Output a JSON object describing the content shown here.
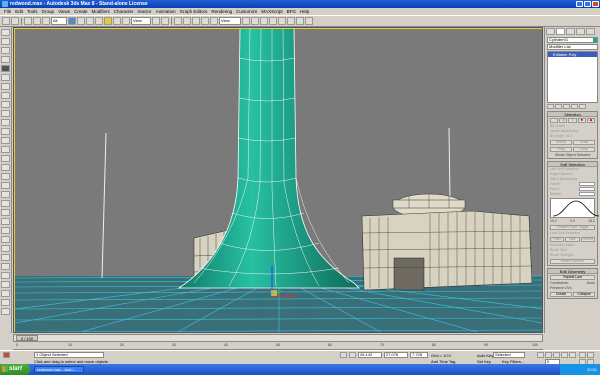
{
  "window": {
    "title": "redwood.max - Autodesk 3ds Max 8 - Stand-alone License"
  },
  "menu": [
    "File",
    "Edit",
    "Tools",
    "Group",
    "Views",
    "Create",
    "Modifiers",
    "Character",
    "reactor",
    "Animation",
    "Graph Editors",
    "Rendering",
    "Customize",
    "MAXScript",
    "BFG",
    "Help"
  ],
  "toolbar": {
    "selection_filter": "All",
    "ref_coord": "View",
    "named_sel": "View"
  },
  "command_panel": {
    "object_name": "Cylinder01",
    "modifier_list": "Modifier List",
    "stack_item": "Editable Poly",
    "selection": {
      "title": "Selection",
      "by_vertex": "By Vertex",
      "ignore_backfacing": "Ignore Backfacing",
      "by_angle": "By Angle:",
      "by_angle_value": "45.0",
      "shrink": "Shrink",
      "grow": "Grow",
      "ring": "Ring",
      "loop": "Loop",
      "status": "Whole Object Selected"
    },
    "soft_selection": {
      "title": "Soft Selection",
      "use_soft": "Use Soft Selection",
      "edge_distance": "Edge Distance",
      "affect_backfacing": "Affect Backfacing",
      "falloff": "Falloff:",
      "pinch": "Pinch:",
      "bubble": "Bubble:",
      "curve_left": "15.2",
      "curve_mid": "0.0",
      "curve_right": "15.2",
      "shaded_face_toggle": "Shaded Face Toggle",
      "lock_soft": "Lock Soft Selection",
      "paint": "Paint",
      "blur": "Blur",
      "revert": "Revert",
      "selection_value": "Selection Value",
      "brush_size": "Brush Size",
      "brush_strength": "Brush Strength",
      "brush_options": "Brush Options"
    },
    "edit_geometry": {
      "title": "Edit Geometry",
      "repeat_last": "Repeat Last",
      "constraints": "Constraints:",
      "constraints_value": "None",
      "preserve_uvs": "Preserve UVs",
      "create": "Create",
      "collapse": "Collapse"
    }
  },
  "timeslider": {
    "label": "0 / 100"
  },
  "ruler_ticks": [
    "0",
    "10",
    "20",
    "30",
    "40",
    "50",
    "60",
    "70",
    "80",
    "90",
    "100"
  ],
  "status": {
    "selection": "1 Object Selected",
    "prompt": "Click and drag to select and move objects",
    "x": "26.142",
    "y": "27.076",
    "z": "7.728",
    "grid": "Grid = 10.0",
    "add_time_tag": "Add Time Tag",
    "autokey": "Auto Key",
    "selected": "Selected",
    "set_key": "Set Key",
    "key_filters": "Key Filters...",
    "frame": "0"
  },
  "taskbar": {
    "start": "start",
    "task1": "redwood.max - Auto...",
    "clock": "22:51"
  },
  "colors": {
    "viewport_bg": "#7a7a7a",
    "tree_teal": "#1fa58c",
    "ground_cyan": "#33b5c9",
    "building_tan": "#d8d2c0",
    "selection_white": "#ffffff"
  }
}
